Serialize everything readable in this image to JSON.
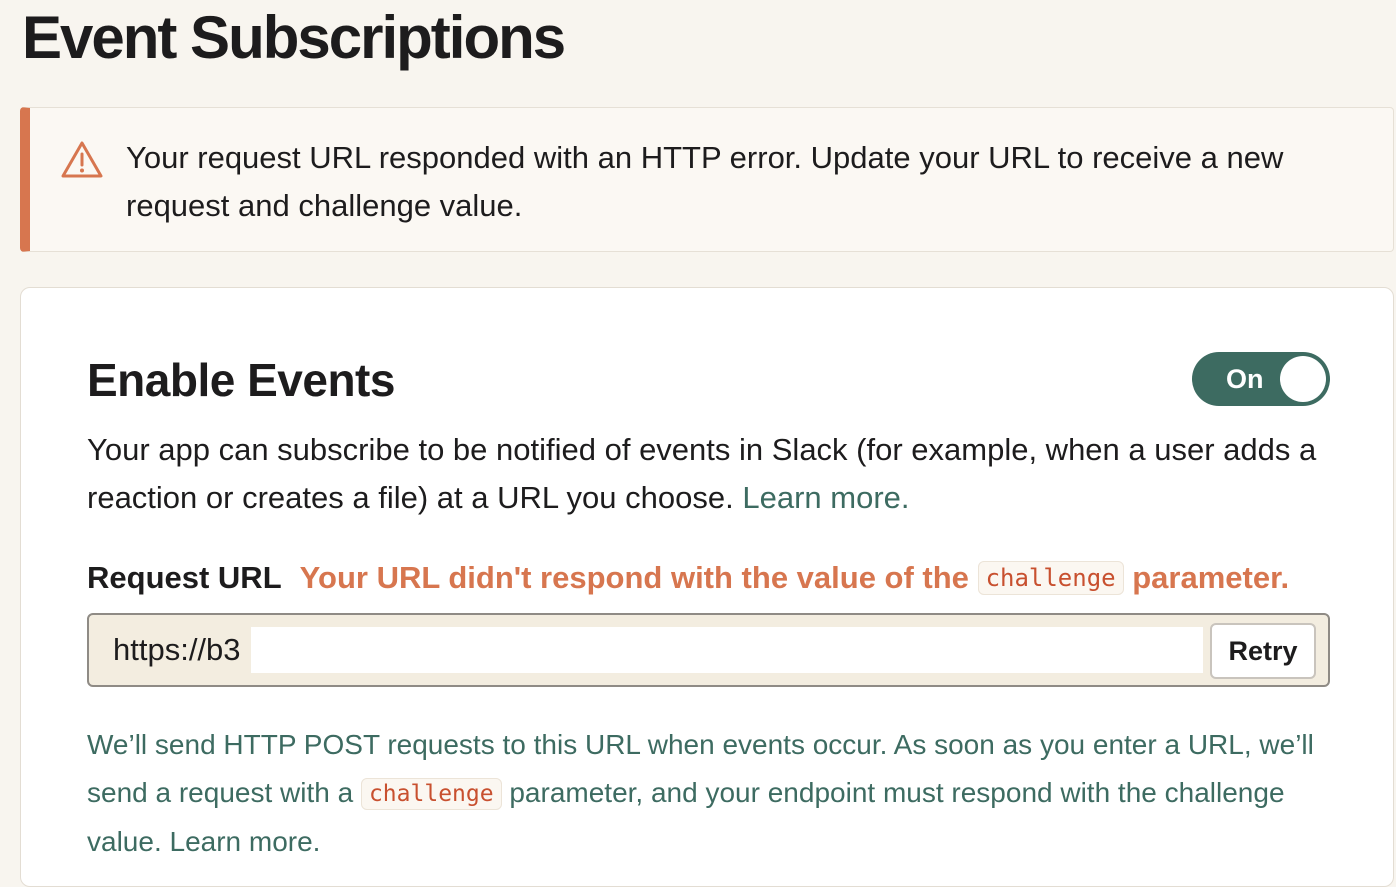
{
  "page": {
    "title": "Event Subscriptions"
  },
  "alert": {
    "icon": "warning-icon",
    "message": "Your request URL responded with an HTTP error. Update your URL to receive a new request and challenge value."
  },
  "enable_events": {
    "title": "Enable Events",
    "toggle": {
      "label": "On",
      "state": "on"
    },
    "description": "Your app can subscribe to be notified of events in Slack (for example, when a user adds a reaction or creates a file) at a URL you choose.",
    "learn_more": "Learn more."
  },
  "request_url": {
    "label": "Request URL",
    "error_before": "Your URL didn't respond with the value of the",
    "error_code": "challenge",
    "error_after": "parameter.",
    "value": "https://b3",
    "retry_label": "Retry"
  },
  "help": {
    "text_before": "We’ll send HTTP POST requests to this URL when events occur. As soon as you enter a URL, we’ll send a request with a",
    "code": "challenge",
    "text_after": "parameter, and your endpoint must respond with the challenge value.",
    "learn_more": "Learn more."
  },
  "colors": {
    "background": "#f8f5ef",
    "accent_green": "#3d6b61",
    "error_orange": "#d7764f",
    "code_red": "#c8502f"
  }
}
